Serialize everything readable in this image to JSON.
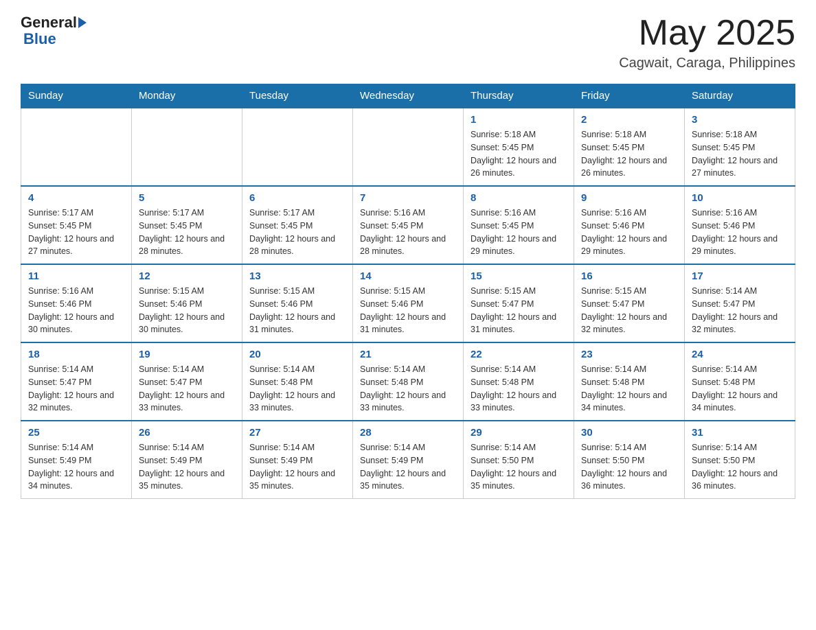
{
  "header": {
    "logo_general": "General",
    "logo_blue": "Blue",
    "month_title": "May 2025",
    "location": "Cagwait, Caraga, Philippines"
  },
  "weekdays": [
    "Sunday",
    "Monday",
    "Tuesday",
    "Wednesday",
    "Thursday",
    "Friday",
    "Saturday"
  ],
  "weeks": [
    [
      {
        "day": "",
        "sunrise": "",
        "sunset": "",
        "daylight": ""
      },
      {
        "day": "",
        "sunrise": "",
        "sunset": "",
        "daylight": ""
      },
      {
        "day": "",
        "sunrise": "",
        "sunset": "",
        "daylight": ""
      },
      {
        "day": "",
        "sunrise": "",
        "sunset": "",
        "daylight": ""
      },
      {
        "day": "1",
        "sunrise": "Sunrise: 5:18 AM",
        "sunset": "Sunset: 5:45 PM",
        "daylight": "Daylight: 12 hours and 26 minutes."
      },
      {
        "day": "2",
        "sunrise": "Sunrise: 5:18 AM",
        "sunset": "Sunset: 5:45 PM",
        "daylight": "Daylight: 12 hours and 26 minutes."
      },
      {
        "day": "3",
        "sunrise": "Sunrise: 5:18 AM",
        "sunset": "Sunset: 5:45 PM",
        "daylight": "Daylight: 12 hours and 27 minutes."
      }
    ],
    [
      {
        "day": "4",
        "sunrise": "Sunrise: 5:17 AM",
        "sunset": "Sunset: 5:45 PM",
        "daylight": "Daylight: 12 hours and 27 minutes."
      },
      {
        "day": "5",
        "sunrise": "Sunrise: 5:17 AM",
        "sunset": "Sunset: 5:45 PM",
        "daylight": "Daylight: 12 hours and 28 minutes."
      },
      {
        "day": "6",
        "sunrise": "Sunrise: 5:17 AM",
        "sunset": "Sunset: 5:45 PM",
        "daylight": "Daylight: 12 hours and 28 minutes."
      },
      {
        "day": "7",
        "sunrise": "Sunrise: 5:16 AM",
        "sunset": "Sunset: 5:45 PM",
        "daylight": "Daylight: 12 hours and 28 minutes."
      },
      {
        "day": "8",
        "sunrise": "Sunrise: 5:16 AM",
        "sunset": "Sunset: 5:45 PM",
        "daylight": "Daylight: 12 hours and 29 minutes."
      },
      {
        "day": "9",
        "sunrise": "Sunrise: 5:16 AM",
        "sunset": "Sunset: 5:46 PM",
        "daylight": "Daylight: 12 hours and 29 minutes."
      },
      {
        "day": "10",
        "sunrise": "Sunrise: 5:16 AM",
        "sunset": "Sunset: 5:46 PM",
        "daylight": "Daylight: 12 hours and 29 minutes."
      }
    ],
    [
      {
        "day": "11",
        "sunrise": "Sunrise: 5:16 AM",
        "sunset": "Sunset: 5:46 PM",
        "daylight": "Daylight: 12 hours and 30 minutes."
      },
      {
        "day": "12",
        "sunrise": "Sunrise: 5:15 AM",
        "sunset": "Sunset: 5:46 PM",
        "daylight": "Daylight: 12 hours and 30 minutes."
      },
      {
        "day": "13",
        "sunrise": "Sunrise: 5:15 AM",
        "sunset": "Sunset: 5:46 PM",
        "daylight": "Daylight: 12 hours and 31 minutes."
      },
      {
        "day": "14",
        "sunrise": "Sunrise: 5:15 AM",
        "sunset": "Sunset: 5:46 PM",
        "daylight": "Daylight: 12 hours and 31 minutes."
      },
      {
        "day": "15",
        "sunrise": "Sunrise: 5:15 AM",
        "sunset": "Sunset: 5:47 PM",
        "daylight": "Daylight: 12 hours and 31 minutes."
      },
      {
        "day": "16",
        "sunrise": "Sunrise: 5:15 AM",
        "sunset": "Sunset: 5:47 PM",
        "daylight": "Daylight: 12 hours and 32 minutes."
      },
      {
        "day": "17",
        "sunrise": "Sunrise: 5:14 AM",
        "sunset": "Sunset: 5:47 PM",
        "daylight": "Daylight: 12 hours and 32 minutes."
      }
    ],
    [
      {
        "day": "18",
        "sunrise": "Sunrise: 5:14 AM",
        "sunset": "Sunset: 5:47 PM",
        "daylight": "Daylight: 12 hours and 32 minutes."
      },
      {
        "day": "19",
        "sunrise": "Sunrise: 5:14 AM",
        "sunset": "Sunset: 5:47 PM",
        "daylight": "Daylight: 12 hours and 33 minutes."
      },
      {
        "day": "20",
        "sunrise": "Sunrise: 5:14 AM",
        "sunset": "Sunset: 5:48 PM",
        "daylight": "Daylight: 12 hours and 33 minutes."
      },
      {
        "day": "21",
        "sunrise": "Sunrise: 5:14 AM",
        "sunset": "Sunset: 5:48 PM",
        "daylight": "Daylight: 12 hours and 33 minutes."
      },
      {
        "day": "22",
        "sunrise": "Sunrise: 5:14 AM",
        "sunset": "Sunset: 5:48 PM",
        "daylight": "Daylight: 12 hours and 33 minutes."
      },
      {
        "day": "23",
        "sunrise": "Sunrise: 5:14 AM",
        "sunset": "Sunset: 5:48 PM",
        "daylight": "Daylight: 12 hours and 34 minutes."
      },
      {
        "day": "24",
        "sunrise": "Sunrise: 5:14 AM",
        "sunset": "Sunset: 5:48 PM",
        "daylight": "Daylight: 12 hours and 34 minutes."
      }
    ],
    [
      {
        "day": "25",
        "sunrise": "Sunrise: 5:14 AM",
        "sunset": "Sunset: 5:49 PM",
        "daylight": "Daylight: 12 hours and 34 minutes."
      },
      {
        "day": "26",
        "sunrise": "Sunrise: 5:14 AM",
        "sunset": "Sunset: 5:49 PM",
        "daylight": "Daylight: 12 hours and 35 minutes."
      },
      {
        "day": "27",
        "sunrise": "Sunrise: 5:14 AM",
        "sunset": "Sunset: 5:49 PM",
        "daylight": "Daylight: 12 hours and 35 minutes."
      },
      {
        "day": "28",
        "sunrise": "Sunrise: 5:14 AM",
        "sunset": "Sunset: 5:49 PM",
        "daylight": "Daylight: 12 hours and 35 minutes."
      },
      {
        "day": "29",
        "sunrise": "Sunrise: 5:14 AM",
        "sunset": "Sunset: 5:50 PM",
        "daylight": "Daylight: 12 hours and 35 minutes."
      },
      {
        "day": "30",
        "sunrise": "Sunrise: 5:14 AM",
        "sunset": "Sunset: 5:50 PM",
        "daylight": "Daylight: 12 hours and 36 minutes."
      },
      {
        "day": "31",
        "sunrise": "Sunrise: 5:14 AM",
        "sunset": "Sunset: 5:50 PM",
        "daylight": "Daylight: 12 hours and 36 minutes."
      }
    ]
  ]
}
